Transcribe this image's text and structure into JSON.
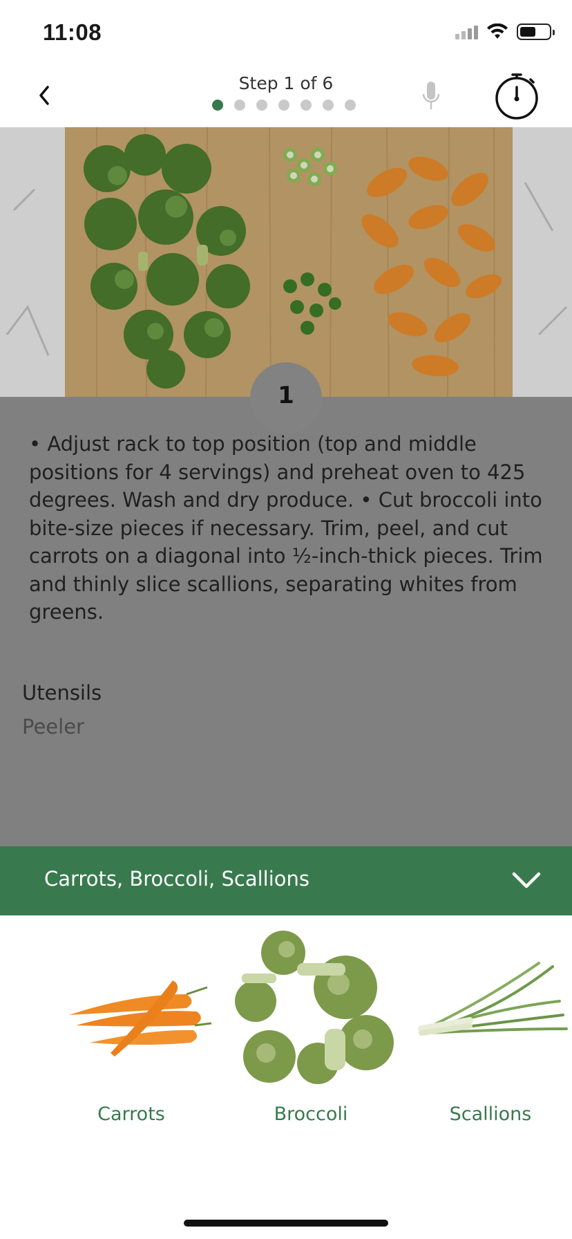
{
  "status_bar": {
    "time": "11:08"
  },
  "nav": {
    "step_title": "Step 1 of 6",
    "dots": [
      true,
      false,
      false,
      false,
      false,
      false,
      false
    ],
    "accent_color": "#37784c"
  },
  "step": {
    "number": "1",
    "instructions": "• Adjust rack to top position (top and middle positions for 4 servings) and preheat oven to 425 degrees. Wash and dry produce. • Cut broccoli into bite-size pieces if necessary. Trim, peel, and cut carrots on a diagonal into ½-inch-thick pieces. Trim and thinly slice scallions, separating whites from greens."
  },
  "utensils": {
    "label": "Utensils",
    "value": "Peeler"
  },
  "ingredients_bar": {
    "title": "Carrots, Broccoli, Scallions",
    "color": "#387a4e"
  },
  "ingredients": [
    {
      "name": "Carrots",
      "icon": "carrots-image"
    },
    {
      "name": "Broccoli",
      "icon": "broccoli-image"
    },
    {
      "name": "Scallions",
      "icon": "scallions-image"
    }
  ]
}
